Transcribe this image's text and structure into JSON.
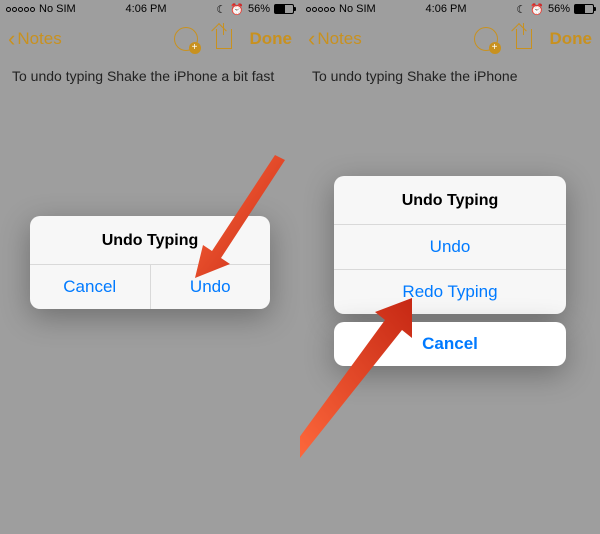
{
  "status": {
    "carrier": "No SIM",
    "time": "4:06 PM",
    "battery_pct": "56%"
  },
  "nav": {
    "back_label": "Notes",
    "done_label": "Done"
  },
  "note": {
    "left_text": "To undo typing Shake the iPhone a bit fast",
    "right_text": "To undo typing Shake the iPhone"
  },
  "dialog_left": {
    "title": "Undo Typing",
    "cancel": "Cancel",
    "undo": "Undo"
  },
  "dialog_right": {
    "title": "Undo Typing",
    "undo": "Undo",
    "redo": "Redo Typing",
    "cancel": "Cancel"
  },
  "colors": {
    "accent_yellow": "#c8911f",
    "ios_blue": "#007aff",
    "arrow_red": "#e6432f"
  }
}
